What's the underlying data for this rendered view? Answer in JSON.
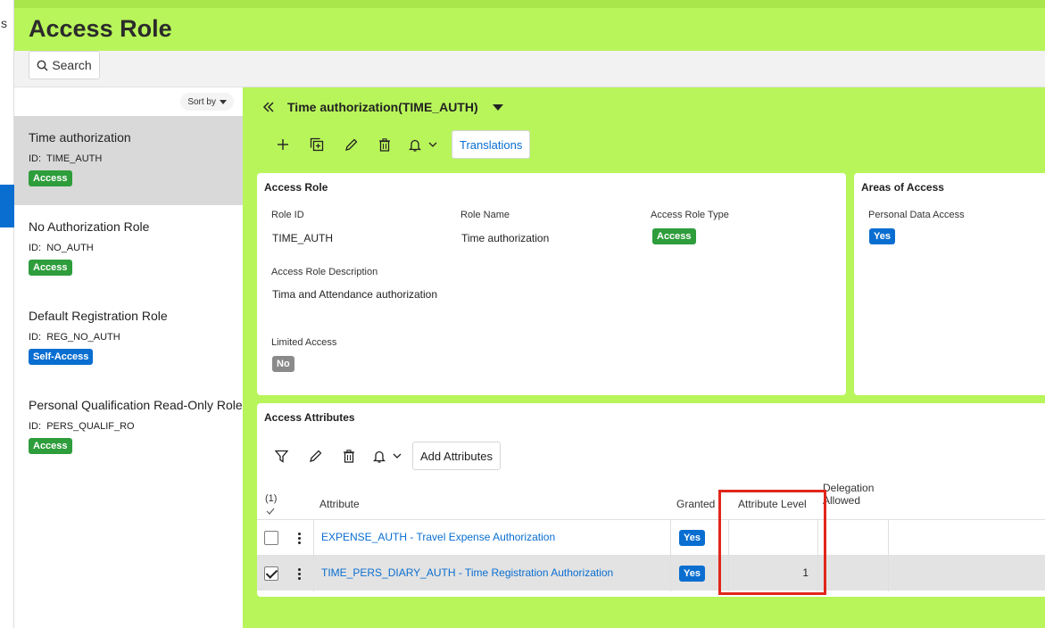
{
  "rail": {
    "letter": "s"
  },
  "header": {
    "title": "Access Role"
  },
  "search": {
    "label": "Search"
  },
  "list": {
    "sort_label": "Sort by",
    "items": [
      {
        "name": "Time authorization",
        "id_label": "ID:",
        "id": "TIME_AUTH",
        "badge": "Access",
        "badge_color": "#2e9d3b"
      },
      {
        "name": "No Authorization Role",
        "id_label": "ID:",
        "id": "NO_AUTH",
        "badge": "Access",
        "badge_color": "#2e9d3b"
      },
      {
        "name": "Default Registration Role",
        "id_label": "ID:",
        "id": "REG_NO_AUTH",
        "badge": "Self-Access",
        "badge_color": "#0a6ed1"
      },
      {
        "name": "Personal Qualification Read-Only Role",
        "id_label": "ID:",
        "id": "PERS_QUALIF_RO",
        "badge": "Access",
        "badge_color": "#2e9d3b"
      }
    ]
  },
  "detail": {
    "title": "Time authorization(TIME_AUTH)",
    "toolbar": {
      "translations_label": "Translations"
    },
    "access_role": {
      "title": "Access Role",
      "role_id_label": "Role ID",
      "role_id": "TIME_AUTH",
      "role_name_label": "Role Name",
      "role_name": "Time authorization",
      "type_label": "Access Role Type",
      "type_value": "Access",
      "desc_label": "Access Role Description",
      "desc_value": "Tima and Attendance authorization",
      "limited_label": "Limited Access",
      "limited_value": "No"
    },
    "areas": {
      "title": "Areas of Access",
      "personal_label": "Personal Data Access",
      "personal_value": "Yes"
    },
    "attributes": {
      "title": "Access Attributes",
      "add_label": "Add Attributes",
      "selected_count": "(1)",
      "columns": {
        "attribute": "Attribute",
        "granted": "Granted",
        "level": "Attribute Level",
        "delegation_line1": "Delegation",
        "delegation_line2": "Allowed"
      },
      "rows": [
        {
          "attribute": "EXPENSE_AUTH - Travel Expense Authorization",
          "granted": "Yes",
          "level": "",
          "checked": false
        },
        {
          "attribute": "TIME_PERS_DIARY_AUTH - Time Registration Authorization",
          "granted": "Yes",
          "level": "1",
          "checked": true
        }
      ]
    }
  },
  "colors": {
    "accent": "#b8f55a",
    "link": "#0a6ed1",
    "green": "#2e9d3b",
    "highlight": "#e0261b"
  }
}
